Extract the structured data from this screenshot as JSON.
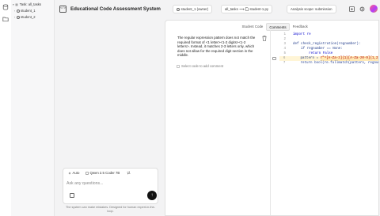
{
  "sidebar": {
    "items": [
      {
        "label": "Task: all_tasks"
      },
      {
        "label": "student_1"
      },
      {
        "label": "student_2"
      }
    ]
  },
  "header": {
    "app_title": "Educational Code Assessment System",
    "user_pill": "student_1 (owner)",
    "path": {
      "from": "all_tasks",
      "arrow": "⟶",
      "file": "student-1.py"
    },
    "scope": "Analysis scope: submission"
  },
  "panel": {
    "tabs": [
      "Student Code",
      "Comments",
      "Feedback"
    ],
    "active_tab": "Comments",
    "comment": "The regular expression pattern does not match the required format of <1 letter><1-2 digits><1-2 letters>. Instead, it matches 2-3 letters only, which does not allow for the required digit section in the middle.",
    "select_code_label": "Select code to add comment",
    "code_lines": [
      {
        "n": "1",
        "parts": [
          {
            "t": "import re",
            "c": "kw"
          }
        ]
      },
      {
        "n": "2",
        "parts": []
      },
      {
        "n": "3",
        "parts": [
          {
            "t": "def check_registration(regnumber):",
            "c": "ct"
          }
        ]
      },
      {
        "n": "4",
        "parts": [
          {
            "t": "    if regnumber == None:",
            "c": "ct"
          }
        ]
      },
      {
        "n": "5",
        "parts": [
          {
            "t": "        return False",
            "c": "kw"
          }
        ]
      },
      {
        "n": "6",
        "parts": [
          {
            "t": "    pattern = ",
            "c": "ct"
          },
          {
            "t": "r\"^[A-Za-z]{1}[A-Za-z0-9]{1,2}",
            "c": "hl"
          }
        ]
      },
      {
        "n": "7",
        "parts": [
          {
            "t": "    return bool(re.fullmatch(pattern, regnum",
            "c": "ct"
          }
        ]
      }
    ]
  },
  "chat": {
    "mode": "Auto",
    "model": "Qwen 2.5 Coder 7B",
    "placeholder": "Ask any questions...",
    "send_icon": "↑",
    "disclaimer": "The system can make mistakes. Designed for human expert-in-the-loop."
  }
}
